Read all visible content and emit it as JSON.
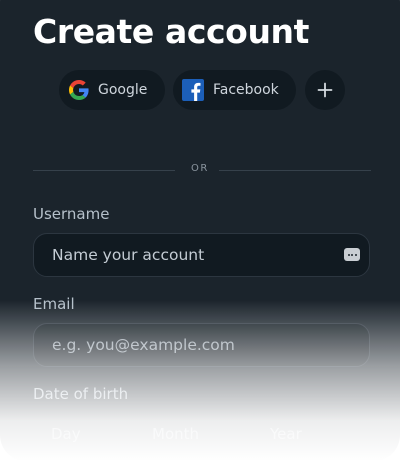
{
  "form": {
    "title": "Create account",
    "social": {
      "google_label": "Google",
      "facebook_label": "Facebook",
      "more_icon": "plus-icon"
    },
    "divider_text": "OR",
    "username": {
      "label": "Username",
      "placeholder": "Name your account",
      "icon": "password-dots-icon"
    },
    "email": {
      "label": "Email",
      "placeholder": "e.g. you@example.com"
    },
    "dob": {
      "label": "Date of birth",
      "day": "Day",
      "month": "Month",
      "year": "Year"
    }
  },
  "colors": {
    "panel_bg": "#1b242c",
    "field_bg": "#111a21",
    "google_blue": "#4285F4",
    "google_red": "#EA4335",
    "google_yellow": "#FBBC05",
    "google_green": "#34A853",
    "facebook_blue": "#1c5fb9"
  }
}
